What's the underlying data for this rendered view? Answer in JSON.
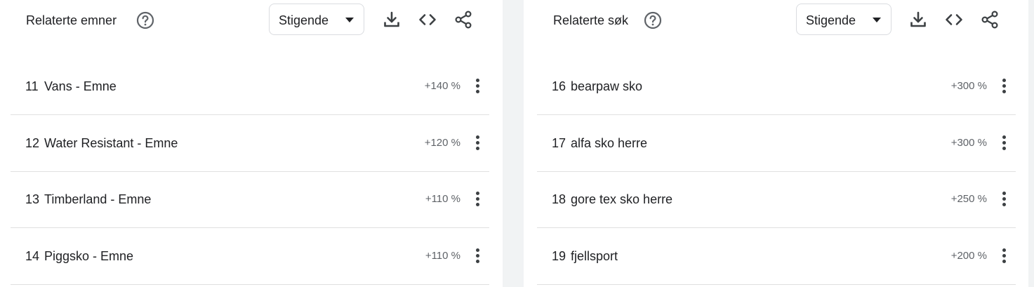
{
  "panels": [
    {
      "title": "Relaterte emner",
      "sort": "Stigende",
      "rows": [
        {
          "rank": "11",
          "label": "Vans - Emne",
          "value": "+140 %"
        },
        {
          "rank": "12",
          "label": "Water Resistant - Emne",
          "value": "+120 %"
        },
        {
          "rank": "13",
          "label": "Timberland - Emne",
          "value": "+110 %"
        },
        {
          "rank": "14",
          "label": "Piggsko - Emne",
          "value": "+110 %"
        }
      ]
    },
    {
      "title": "Relaterte søk",
      "sort": "Stigende",
      "rows": [
        {
          "rank": "16",
          "label": "bearpaw sko",
          "value": "+300 %"
        },
        {
          "rank": "17",
          "label": "alfa sko herre",
          "value": "+300 %"
        },
        {
          "rank": "18",
          "label": "gore tex sko herre",
          "value": "+250 %"
        },
        {
          "rank": "19",
          "label": "fjellsport",
          "value": "+200 %"
        }
      ]
    }
  ],
  "icons": {
    "help": "help-circle-icon",
    "download": "download-icon",
    "embed": "code-icon",
    "share": "share-icon",
    "row_menu": "more-vert-icon"
  },
  "colors": {
    "text": "#202124",
    "secondary_text": "#5f6368",
    "divider": "#e0e0e0",
    "background": "#f1f3f4"
  }
}
